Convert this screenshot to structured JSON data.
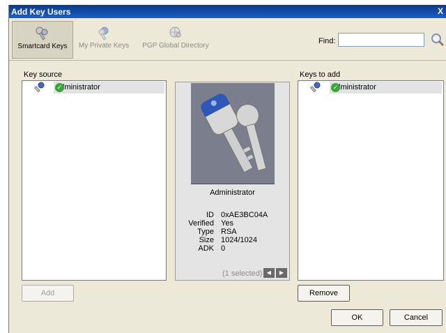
{
  "window": {
    "title": "Add Key Users",
    "close_glyph": "X"
  },
  "toolbar": {
    "tabs": [
      {
        "label": "Smartcard Keys",
        "icon": "smartcard-keys-icon"
      },
      {
        "label": "My Private Keys",
        "icon": "private-keys-icon"
      },
      {
        "label": "PGP Global Directory",
        "icon": "global-directory-icon"
      }
    ],
    "find_label": "Find:",
    "find_value": ""
  },
  "key_source": {
    "label": "Key source",
    "items": [
      {
        "name": "Administrator",
        "verified": true
      }
    ]
  },
  "preview": {
    "name": "Administrator",
    "props": [
      {
        "k": "ID",
        "v": "0xAE3BC04A"
      },
      {
        "k": "Verified",
        "v": "Yes"
      },
      {
        "k": "Type",
        "v": "RSA"
      },
      {
        "k": "Size",
        "v": "1024/1024"
      },
      {
        "k": "ADK",
        "v": "0"
      }
    ],
    "selected_text": "(1 selected)"
  },
  "keys_to_add": {
    "label": "Keys to add",
    "items": [
      {
        "name": "Administrator",
        "verified": true
      }
    ]
  },
  "buttons": {
    "add": "Add",
    "remove": "Remove",
    "ok": "OK",
    "cancel": "Cancel"
  }
}
